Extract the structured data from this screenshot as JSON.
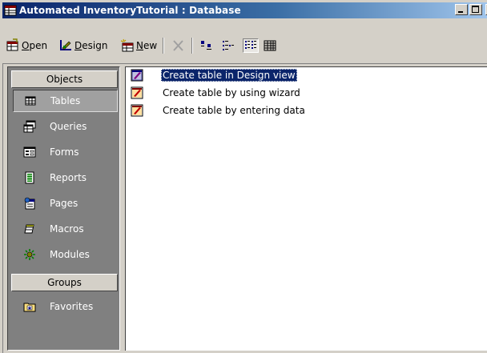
{
  "window": {
    "title": "Automated InventoryTutorial : Database",
    "app_icon": "database-icon",
    "controls": [
      "minimize-icon",
      "maximize-icon",
      "close-icon"
    ]
  },
  "toolbar": {
    "open_label": "Open",
    "design_label": "Design",
    "new_label": "New",
    "icons": [
      "open-icon",
      "design-icon",
      "new-icon",
      "delete-icon",
      "large-icons-icon",
      "small-icons-icon",
      "list-view-icon",
      "details-view-icon"
    ]
  },
  "objects_bar": {
    "objects_header": "Objects",
    "items": [
      {
        "label": "Tables",
        "icon": "table-icon",
        "selected": true
      },
      {
        "label": "Queries",
        "icon": "query-icon",
        "selected": false
      },
      {
        "label": "Forms",
        "icon": "form-icon",
        "selected": false
      },
      {
        "label": "Reports",
        "icon": "report-icon",
        "selected": false
      },
      {
        "label": "Pages",
        "icon": "page-icon",
        "selected": false
      },
      {
        "label": "Macros",
        "icon": "macro-icon",
        "selected": false
      },
      {
        "label": "Modules",
        "icon": "module-icon",
        "selected": false
      }
    ],
    "groups_header": "Groups",
    "groups": [
      {
        "label": "Favorites",
        "icon": "favorites-folder-icon"
      }
    ]
  },
  "list": {
    "items": [
      {
        "label": "Create table in Design view",
        "icon": "design-view-shortcut-icon",
        "selected": true
      },
      {
        "label": "Create table by using wizard",
        "icon": "wizard-shortcut-icon",
        "selected": false
      },
      {
        "label": "Create table by entering data",
        "icon": "datasheet-shortcut-icon",
        "selected": false
      }
    ]
  },
  "colors": {
    "title_gradient_start": "#0a246a",
    "title_gradient_end": "#a6caf0",
    "selection": "#0a246a",
    "objects_bar_bg": "#808080",
    "chrome": "#d4d0c8"
  }
}
